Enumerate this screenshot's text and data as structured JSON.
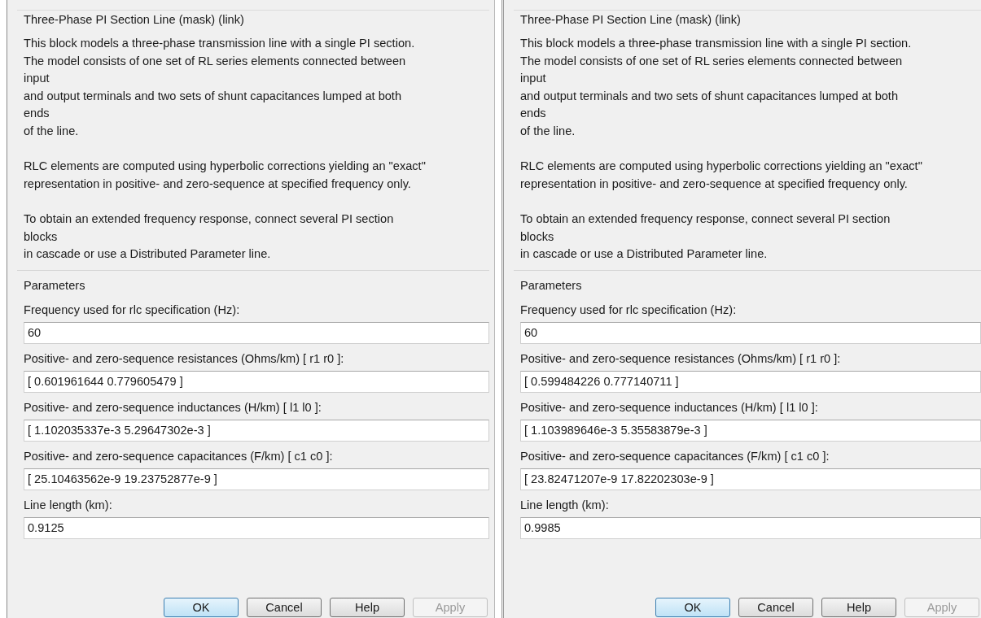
{
  "dialogs": [
    {
      "title": "Three-Phase PI Section Line (mask) (link)",
      "description": [
        "This block models a three-phase transmission line with a single PI section.\nThe model consists of one set of RL series elements connected between\ninput\nand output terminals and two sets of shunt capacitances lumped at both\nends\nof the line.",
        "RLC elements are computed using hyperbolic corrections yielding an \"exact\"\nrepresentation in positive- and zero-sequence at specified frequency only.",
        "To obtain an extended frequency response, connect several PI section\nblocks\nin cascade or use a Distributed Parameter line."
      ],
      "parameters_title": "Parameters",
      "parameters": [
        {
          "label": "Frequency used for rlc specification (Hz):",
          "value": "60"
        },
        {
          "label": "Positive- and zero-sequence resistances (Ohms/km) [ r1  r0 ]:",
          "value": "[ 0.601961644 0.779605479 ]"
        },
        {
          "label": "Positive- and zero-sequence inductances (H/km) [ l1  l0 ]:",
          "value": "[ 1.102035337e-3 5.29647302e-3 ]"
        },
        {
          "label": "Positive- and zero-sequence capacitances (F/km) [ c1 c0 ]:",
          "value": "[ 25.10463562e-9 19.23752877e-9 ]"
        },
        {
          "label": "Line length (km):",
          "value": "0.9125"
        }
      ],
      "buttons": [
        {
          "label": "OK",
          "default": true,
          "disabled": false
        },
        {
          "label": "Cancel",
          "default": false,
          "disabled": false
        },
        {
          "label": "Help",
          "default": false,
          "disabled": false
        },
        {
          "label": "Apply",
          "default": false,
          "disabled": true
        }
      ]
    },
    {
      "title": "Three-Phase PI Section Line (mask) (link)",
      "description": [
        "This block models a three-phase transmission line with a single PI section.\nThe model consists of one set of RL series elements connected between\ninput\nand output terminals and two sets of shunt capacitances lumped at both\nends\nof the line.",
        "RLC elements are computed using hyperbolic corrections yielding an \"exact\"\nrepresentation in positive- and zero-sequence at specified frequency only.",
        "To obtain an extended frequency response, connect several PI section\nblocks\nin cascade or use a Distributed Parameter line."
      ],
      "parameters_title": "Parameters",
      "parameters": [
        {
          "label": "Frequency used for rlc specification (Hz):",
          "value": "60"
        },
        {
          "label": "Positive- and zero-sequence resistances (Ohms/km) [ r1  r0 ]:",
          "value": "[ 0.599484226 0.777140711 ]"
        },
        {
          "label": "Positive- and zero-sequence inductances (H/km) [ l1  l0 ]:",
          "value": "[ 1.103989646e-3 5.35583879e-3 ]"
        },
        {
          "label": "Positive- and zero-sequence capacitances (F/km) [ c1 c0 ]:",
          "value": "[ 23.82471207e-9 17.82202303e-9 ]"
        },
        {
          "label": "Line length (km):",
          "value": "0.9985"
        }
      ],
      "buttons": [
        {
          "label": "OK",
          "default": true,
          "disabled": false
        },
        {
          "label": "Cancel",
          "default": false,
          "disabled": false
        },
        {
          "label": "Help",
          "default": false,
          "disabled": false
        },
        {
          "label": "Apply",
          "default": false,
          "disabled": true
        }
      ]
    }
  ]
}
